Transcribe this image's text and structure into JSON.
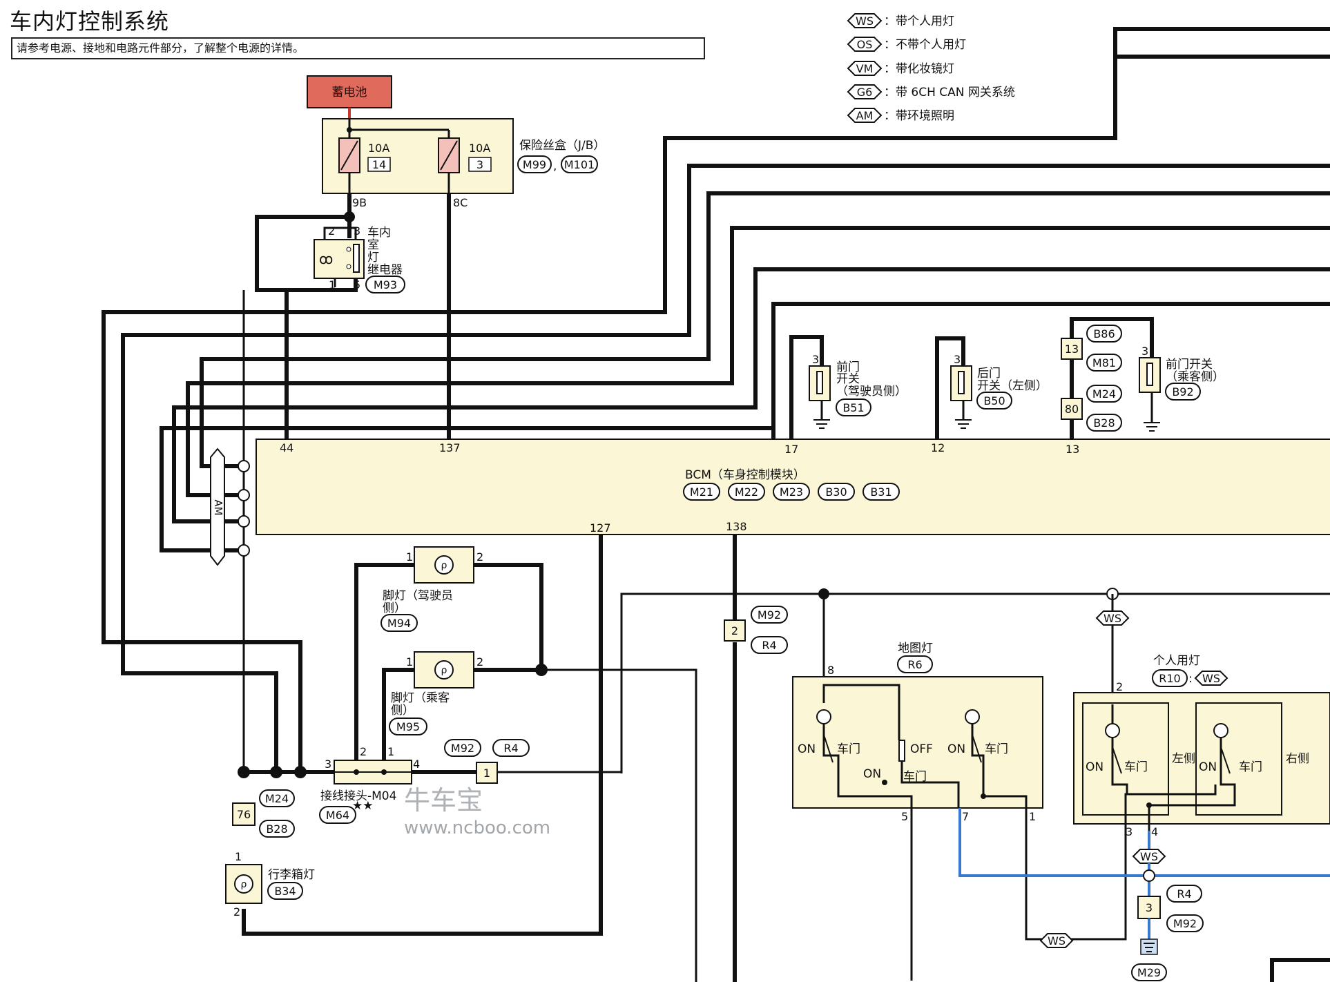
{
  "title": "车内灯控制系统",
  "note": "请参考电源、接地和电路元件部分，了解整个电源的详情。",
  "legend": [
    {
      "code": "WS",
      "text": "：带个人用灯"
    },
    {
      "code": "OS",
      "text": "：不带个人用灯"
    },
    {
      "code": "VM",
      "text": "：带化妆镜灯"
    },
    {
      "code": "G6",
      "text": "：带 6CH CAN 网关系统"
    },
    {
      "code": "AM",
      "text": "：带环境照明"
    }
  ],
  "battery": "蓄电池",
  "fuse_box": {
    "label": "保险丝盒（J/B）",
    "connectors": [
      "M99",
      "M101"
    ],
    "fuses": [
      {
        "rating": "10A",
        "num": "14",
        "out": "9B"
      },
      {
        "rating": "10A",
        "num": "3",
        "out": "8C"
      }
    ]
  },
  "relay": {
    "label": [
      "车内",
      "室",
      "灯",
      "继电器"
    ],
    "connector": "M93",
    "pins": [
      "2",
      "3",
      "1",
      "5"
    ]
  },
  "bcm": {
    "label": "BCM（车身控制模块）",
    "connectors": [
      "M21",
      "M22",
      "M23",
      "B30",
      "B31"
    ],
    "top_pins": [
      "44",
      "137",
      "17",
      "12",
      "13"
    ],
    "bottom_pins": [
      "127",
      "138"
    ]
  },
  "am_label": "AM",
  "front_door_switch_driver": {
    "label": [
      "前门",
      "开关",
      "（驾驶员侧）"
    ],
    "connector": "B51",
    "pin": "3"
  },
  "rear_door_switch": {
    "label": [
      "后门",
      "开关（左侧）"
    ],
    "connector": "B50",
    "pin": "3"
  },
  "front_door_switch_passenger": {
    "label": [
      "前门开关",
      "（乘客侧）"
    ],
    "connector": "B92",
    "pin": "3"
  },
  "rear_harness": {
    "connectors": [
      "B86",
      "M81",
      "M24",
      "B28"
    ],
    "pins": [
      "13",
      "80"
    ]
  },
  "foot_lamp_driver": {
    "label": [
      "脚灯（驾驶员",
      "侧）"
    ],
    "connector": "M94",
    "pins": [
      "1",
      "2"
    ]
  },
  "foot_lamp_passenger": {
    "label": [
      "脚灯（乘客",
      "侧）"
    ],
    "connector": "M95",
    "pins": [
      "1",
      "2"
    ]
  },
  "joint": {
    "label": "接线接头-M04",
    "stars": "★★",
    "connector": "M64",
    "pins": [
      "3",
      "2",
      "1",
      "4"
    ]
  },
  "mid_connector": {
    "pin": "1",
    "tags": [
      "M92",
      "R4"
    ]
  },
  "left_connector": {
    "pin": "76",
    "tags": [
      "M24",
      "B28"
    ]
  },
  "trunk_lamp": {
    "label": "行李箱灯",
    "connector": "B34",
    "pins": [
      "1",
      "2"
    ]
  },
  "m92_r4_connector": {
    "pin": "2",
    "tags": [
      "M92",
      "R4"
    ]
  },
  "map_lamp": {
    "label": "地图灯",
    "connector": "R6",
    "pins": [
      "8",
      "5",
      "7",
      "1"
    ],
    "switch_labels": [
      "ON",
      "车门",
      "OFF",
      "ON",
      "车门",
      "ON",
      "车门"
    ]
  },
  "personal_lamp": {
    "label": "个人用灯",
    "connector": "R10",
    "option": "WS",
    "pins": [
      "2",
      "3",
      "4"
    ],
    "switch_labels": [
      "ON",
      "车门",
      "左侧",
      "ON",
      "车门",
      "右侧"
    ]
  },
  "ground_connector": {
    "pin": "3",
    "tags": [
      "R4",
      "M92"
    ],
    "ground": "M29"
  },
  "ws_tags": [
    "WS",
    "WS",
    "WS"
  ],
  "watermark": {
    "brand": "牛车宝",
    "url": "www.ncboo.com"
  },
  "colors": {
    "battery": "#e06a5c",
    "component": "#fbf6d6",
    "blue_wire": "#3a78d0"
  }
}
